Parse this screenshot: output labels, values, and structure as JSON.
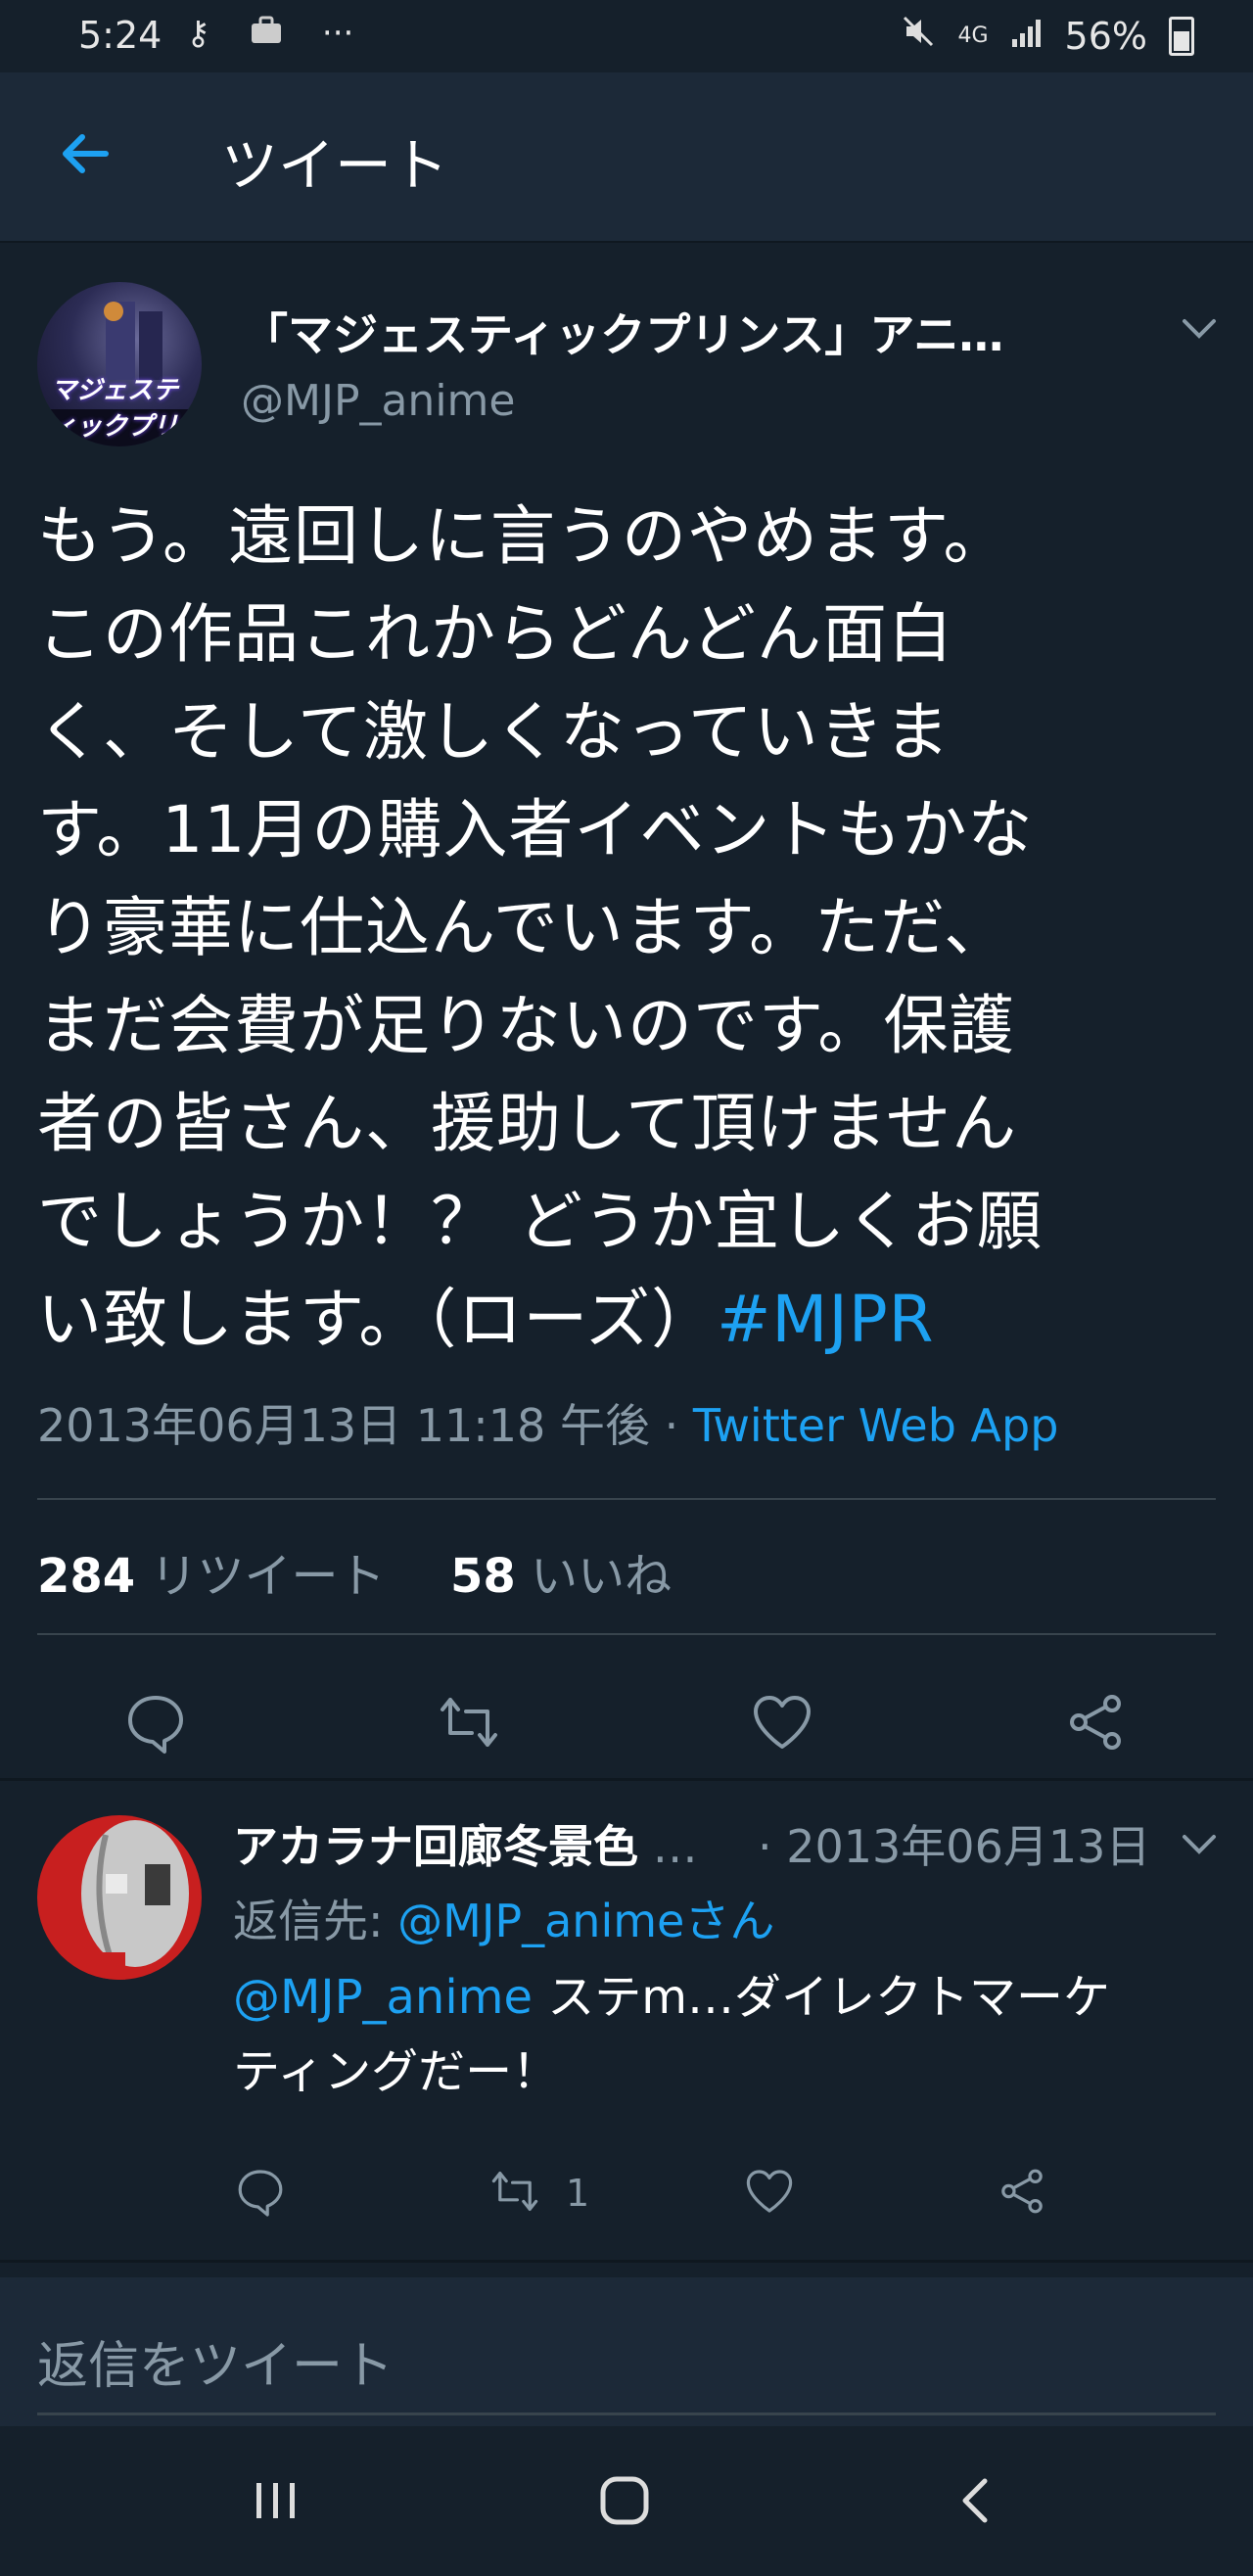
{
  "status_bar": {
    "time": "5:24",
    "network": "4G",
    "battery": "56%",
    "icons": [
      "key-icon",
      "briefcase-icon",
      "more-dots-icon",
      "mute-icon",
      "signal-icon",
      "battery-icon"
    ]
  },
  "app_bar": {
    "title": "ツイート",
    "back_icon": "arrow-left-icon",
    "accent": "#1da1f2"
  },
  "tweet": {
    "author_name": "「マジェスティックプリンス」アニ…",
    "author_handle": "@MJP_anime",
    "avatar_text": "マジェスティックプリンス",
    "text_lines": [
      "もう。遠回しに言うのやめます。",
      "この作品これからどんどん面白",
      "く、そして激しくなっていきま",
      "す。11月の購入者イベントもかな",
      "り豪華に仕込んでいます。ただ、",
      "まだ会費が足りないのです。保護",
      "者の皆さん、援助して頂けません",
      "でしょうか！？ どうか宜しくお願",
      "い致します。（ローズ）"
    ],
    "hashtag": "#MJPR",
    "timestamp": "2013年06月13日 11:18 午後",
    "separator": " · ",
    "source": "Twitter Web App",
    "retweet_count": "284",
    "retweet_label": "リツイート",
    "like_count": "58",
    "like_label": "いいね"
  },
  "reply": {
    "author_name": "アカラナ回廊冬景色",
    "ellipsis": " …",
    "date": "· 2013年06月13日",
    "reply_to_label": "返信先: ",
    "reply_to_handle": "@MJP_animeさん",
    "mention": "@MJP_anime",
    "text_1": " ステm…ダイレクトマーケ",
    "text_2": "ティングだー！",
    "retweet_count": "1"
  },
  "compose": {
    "placeholder": "返信をツイート"
  },
  "colors": {
    "background": "#15202b",
    "header": "#1c2938",
    "muted": "#8899a6",
    "link": "#1da1f2"
  }
}
